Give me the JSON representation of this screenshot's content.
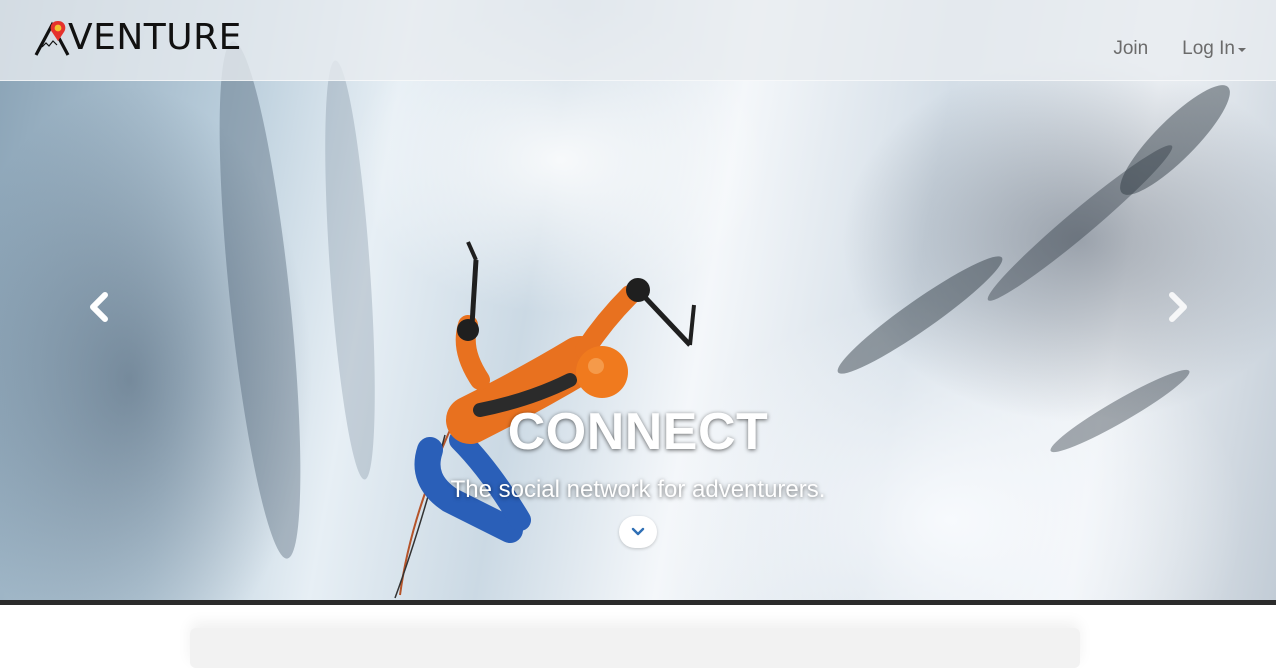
{
  "brand": {
    "name": "VENTURE",
    "logo_icon": "mountain-pin-logo",
    "pin_color": "#e5322d",
    "pin_center_color": "#f2c230"
  },
  "nav": {
    "join_label": "Join",
    "login_label": "Log In"
  },
  "carousel": {
    "prev_icon": "chevron-left-icon",
    "next_icon": "chevron-right-icon",
    "title": "CONNECT",
    "subtitle": "The social network for adventurers.",
    "scroll_icon": "chevron-down-icon",
    "scroll_icon_color": "#2f6fb5"
  }
}
